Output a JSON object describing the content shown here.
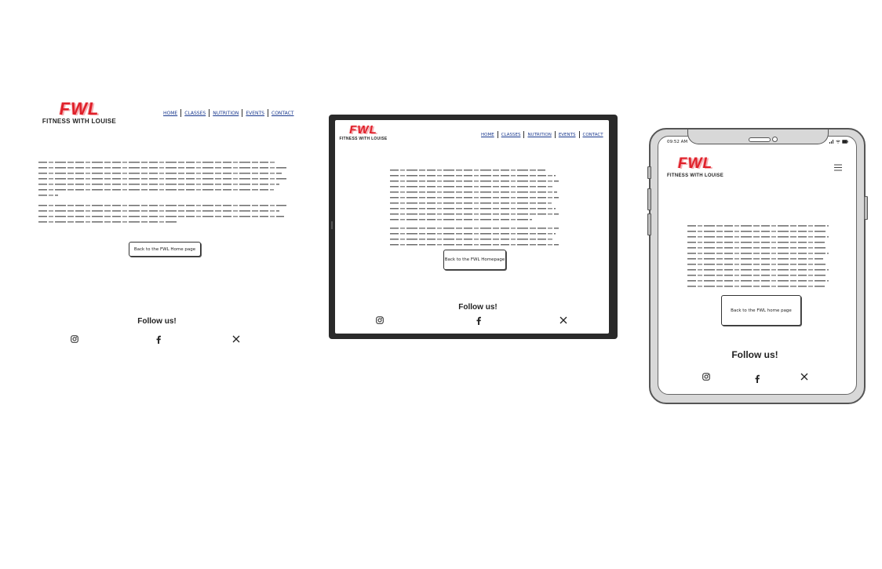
{
  "brand": {
    "logo_mark": "FWL",
    "logo_subtitle": "FITNESS WITH LOUISE",
    "accent_color": "#e0202a",
    "link_color": "#1b3a8f"
  },
  "nav": [
    "HOME",
    "CLASSES",
    "NUTRITION",
    "EVENTS",
    "CONTACT"
  ],
  "desktop": {
    "back_button": "Back to the FWL Home page",
    "follow_heading": "Follow us!"
  },
  "tablet": {
    "back_button": "Back to the FWL Homepage",
    "follow_heading": "Follow us!"
  },
  "mobile": {
    "status_time": "09:52 AM",
    "menu_icon": "hamburger-menu-icon",
    "back_button": "Back to the FWL home page",
    "follow_heading": "Follow us!"
  },
  "social_icons": [
    "instagram-icon",
    "facebook-icon",
    "x-twitter-icon"
  ]
}
